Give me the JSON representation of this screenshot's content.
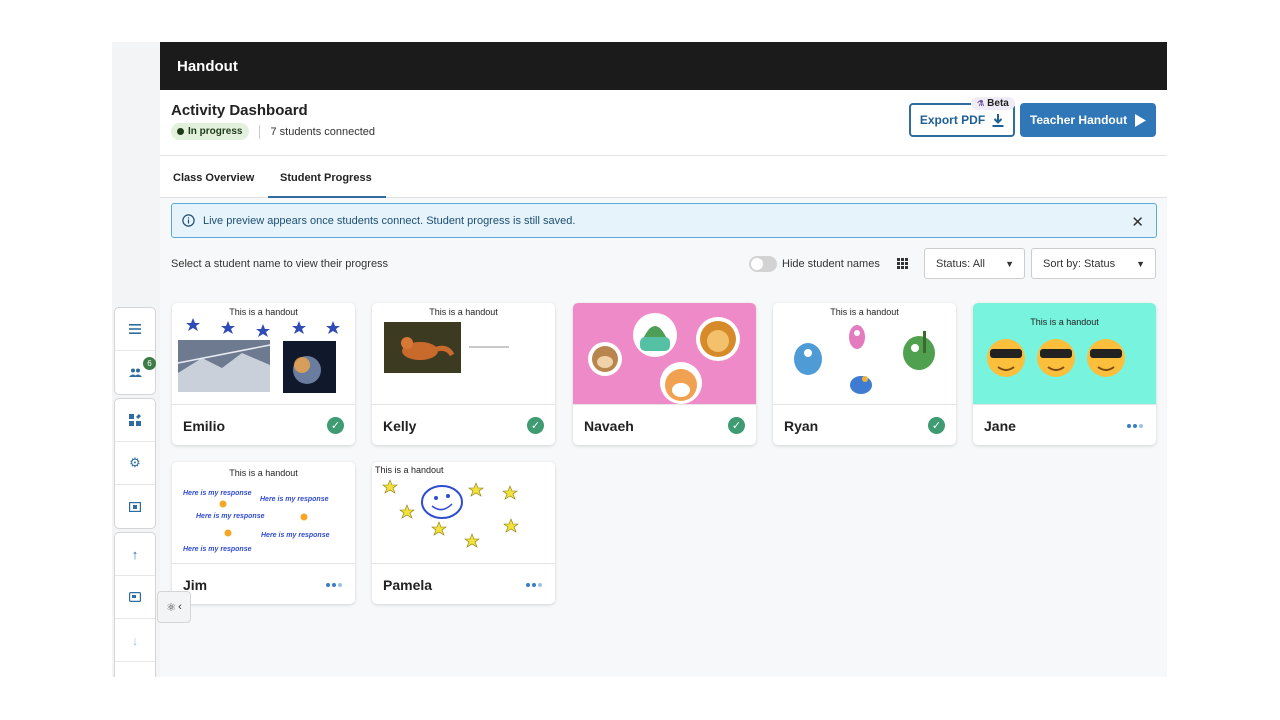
{
  "app": {
    "title": "Handout"
  },
  "header": {
    "title": "Activity Dashboard",
    "status": "In progress",
    "connected": "7 students connected",
    "export_label": "Export PDF",
    "beta_label": "Beta",
    "teacher_label": "Teacher Handout"
  },
  "tabs": [
    {
      "label": "Class Overview"
    },
    {
      "label": "Student Progress",
      "active": true
    }
  ],
  "info": {
    "text": "Live preview appears once students connect. Student progress is still saved."
  },
  "controls": {
    "instruction": "Select a student name to view their progress",
    "hide_names_label": "Hide student names",
    "status_filter": "Status: All",
    "sort_by": "Sort by: Status"
  },
  "sidenav": {
    "badge_count": "6"
  },
  "handout_title": "This is a handout",
  "response_text": "Here is my response",
  "students": [
    {
      "name": "Emilio",
      "status": "complete"
    },
    {
      "name": "Kelly",
      "status": "complete"
    },
    {
      "name": "Navaeh",
      "status": "complete"
    },
    {
      "name": "Ryan",
      "status": "complete"
    },
    {
      "name": "Jane",
      "status": "in-progress"
    },
    {
      "name": "Jim",
      "status": "in-progress"
    },
    {
      "name": "Pamela",
      "status": "in-progress"
    }
  ],
  "colors": {
    "accent": "#2f77b7",
    "complete": "#3e9b72",
    "topbar": "#1b1b1b",
    "navaeh_bg": "#ee8ac8",
    "jane_bg": "#78f3dd"
  }
}
